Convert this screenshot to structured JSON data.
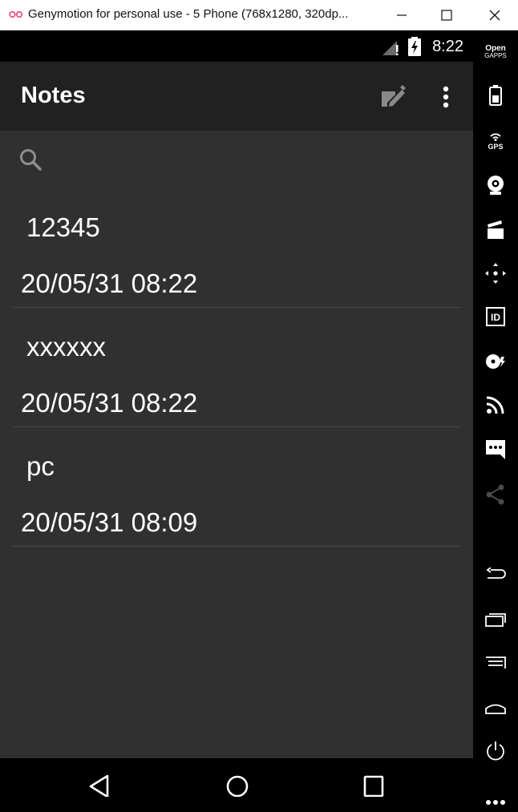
{
  "window": {
    "title": "Genymotion for personal use - 5 Phone (768x1280, 320dp...",
    "logo_icon": "genymotion-logo-icon",
    "minimize_icon": "minimize-icon",
    "maximize_icon": "maximize-icon",
    "close_icon": "close-icon"
  },
  "status_bar": {
    "time": "8:22",
    "icons": [
      "signal-icon",
      "battery-charging-icon"
    ]
  },
  "action_bar": {
    "title": "Notes",
    "actions": [
      "compose-icon",
      "overflow-menu-icon"
    ]
  },
  "search": {
    "placeholder": "",
    "value": "",
    "icon": "search-icon"
  },
  "notes": [
    {
      "title": "12345",
      "date": "20/05/31 08:22"
    },
    {
      "title": "xxxxxx",
      "date": "20/05/31 08:22"
    },
    {
      "title": "pc",
      "date": "20/05/31 08:09"
    }
  ],
  "navigation_bar": {
    "buttons": [
      "back-icon",
      "home-icon",
      "recents-icon"
    ]
  },
  "sidebar": {
    "opengapps_line1": "Open",
    "opengapps_line2": "GAPPS",
    "gps_label": "GPS",
    "id_label": "ID",
    "tools": [
      "opengapps-icon",
      "battery-icon",
      "gps-icon",
      "camera-icon",
      "media-icon",
      "dpad-icon",
      "id-icon",
      "disk-icon",
      "rss-icon",
      "sms-icon",
      "share-icon",
      "back-icon",
      "recents-icon",
      "menu-icon",
      "home-icon",
      "power-icon",
      "more-icon"
    ]
  },
  "colors": {
    "action_bar": "#212121",
    "content_bg": "#303030",
    "divider": "#474747",
    "text": "#ffffff"
  }
}
